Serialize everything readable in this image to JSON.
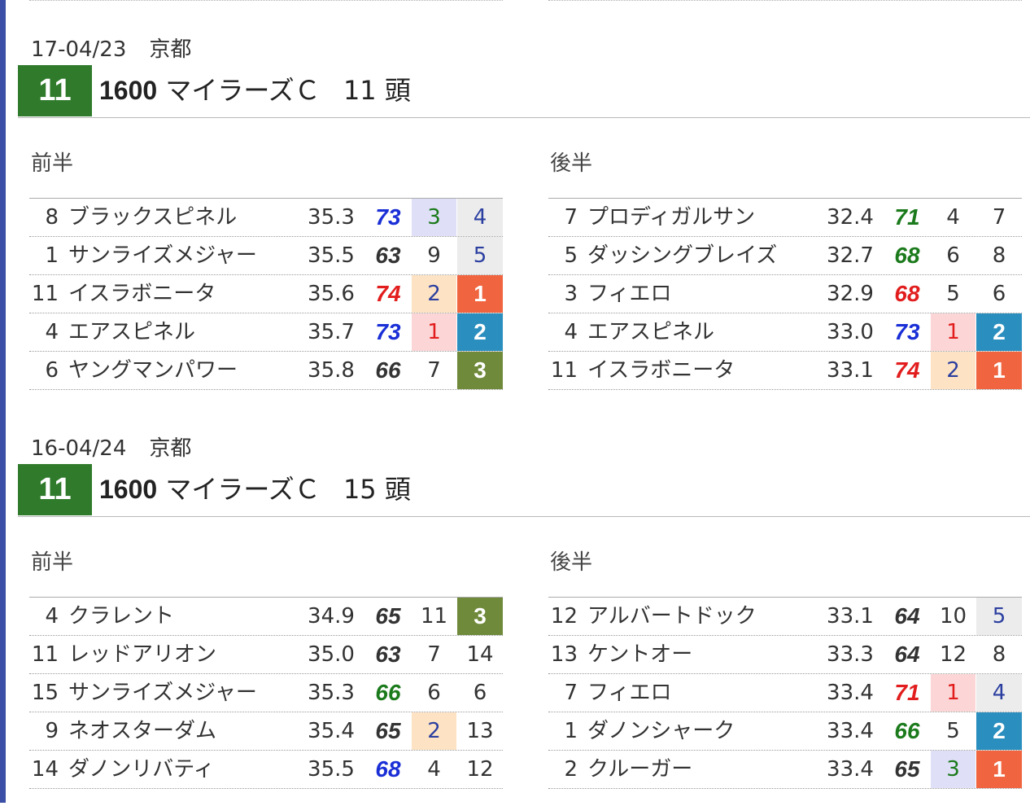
{
  "colors": {
    "race_number_bg": "#2f7a2b",
    "rank1": "#f06440",
    "rank2": "#2a8fbf",
    "rank3": "#6e8a3a",
    "index_blue": "#1a2fd6",
    "index_red": "#e21d1d",
    "index_green": "#1b7a1b",
    "index_black": "#333333",
    "pink_bg": "#fcd6d6",
    "peach_bg": "#fde3c3",
    "lavender_bg": "#dfdff7",
    "grey_bg": "#ececec"
  },
  "races": [
    {
      "date": "17-04/23",
      "venue": "京都",
      "race_number": "11",
      "distance": "1600",
      "name": "マイラーズＣ",
      "count": "11 頭",
      "first_half": {
        "label": "前半",
        "rows": [
          {
            "num": "8",
            "name": "ブラックスピネル",
            "time": "35.3",
            "index": "73",
            "index_color": "blue",
            "rank_a": "3",
            "rank_a_bg": "lavender",
            "rank_a_color": "#1b7a1b",
            "rank_b": "4",
            "rank_b_bg": "grey",
            "rank_b_color": "#2b3fa0"
          },
          {
            "num": "1",
            "name": "サンライズメジャー",
            "time": "35.5",
            "index": "63",
            "index_color": "black",
            "rank_a": "9",
            "rank_a_bg": "",
            "rank_a_color": "#333",
            "rank_b": "5",
            "rank_b_bg": "grey",
            "rank_b_color": "#2b3fa0"
          },
          {
            "num": "11",
            "name": "イスラボニータ",
            "time": "35.6",
            "index": "74",
            "index_color": "red",
            "rank_a": "2",
            "rank_a_bg": "peach",
            "rank_a_color": "#2b3fa0",
            "rank_b": "1",
            "rank_b_bg": "rank1",
            "rank_b_color": "#ffffff"
          },
          {
            "num": "4",
            "name": "エアスピネル",
            "time": "35.7",
            "index": "73",
            "index_color": "blue",
            "rank_a": "1",
            "rank_a_bg": "pink",
            "rank_a_color": "#e21d1d",
            "rank_b": "2",
            "rank_b_bg": "rank2",
            "rank_b_color": "#ffffff"
          },
          {
            "num": "6",
            "name": "ヤングマンパワー",
            "time": "35.8",
            "index": "66",
            "index_color": "black",
            "rank_a": "7",
            "rank_a_bg": "",
            "rank_a_color": "#333",
            "rank_b": "3",
            "rank_b_bg": "rank3",
            "rank_b_color": "#ffffff"
          }
        ]
      },
      "second_half": {
        "label": "後半",
        "rows": [
          {
            "num": "7",
            "name": "プロディガルサン",
            "time": "32.4",
            "index": "71",
            "index_color": "green",
            "rank_a": "4",
            "rank_a_bg": "",
            "rank_a_color": "#333",
            "rank_b": "7",
            "rank_b_bg": "",
            "rank_b_color": "#333"
          },
          {
            "num": "5",
            "name": "ダッシングブレイズ",
            "time": "32.7",
            "index": "68",
            "index_color": "green",
            "rank_a": "6",
            "rank_a_bg": "",
            "rank_a_color": "#333",
            "rank_b": "8",
            "rank_b_bg": "",
            "rank_b_color": "#333"
          },
          {
            "num": "3",
            "name": "フィエロ",
            "time": "32.9",
            "index": "68",
            "index_color": "red",
            "rank_a": "5",
            "rank_a_bg": "",
            "rank_a_color": "#333",
            "rank_b": "6",
            "rank_b_bg": "",
            "rank_b_color": "#333"
          },
          {
            "num": "4",
            "name": "エアスピネル",
            "time": "33.0",
            "index": "73",
            "index_color": "blue",
            "rank_a": "1",
            "rank_a_bg": "pink",
            "rank_a_color": "#e21d1d",
            "rank_b": "2",
            "rank_b_bg": "rank2",
            "rank_b_color": "#ffffff"
          },
          {
            "num": "11",
            "name": "イスラボニータ",
            "time": "33.1",
            "index": "74",
            "index_color": "red",
            "rank_a": "2",
            "rank_a_bg": "peach",
            "rank_a_color": "#2b3fa0",
            "rank_b": "1",
            "rank_b_bg": "rank1",
            "rank_b_color": "#ffffff"
          }
        ]
      }
    },
    {
      "date": "16-04/24",
      "venue": "京都",
      "race_number": "11",
      "distance": "1600",
      "name": "マイラーズＣ",
      "count": "15 頭",
      "first_half": {
        "label": "前半",
        "rows": [
          {
            "num": "4",
            "name": "クラレント",
            "time": "34.9",
            "index": "65",
            "index_color": "black",
            "rank_a": "11",
            "rank_a_bg": "",
            "rank_a_color": "#333",
            "rank_b": "3",
            "rank_b_bg": "rank3",
            "rank_b_color": "#ffffff"
          },
          {
            "num": "11",
            "name": "レッドアリオン",
            "time": "35.0",
            "index": "63",
            "index_color": "black",
            "rank_a": "7",
            "rank_a_bg": "",
            "rank_a_color": "#333",
            "rank_b": "14",
            "rank_b_bg": "",
            "rank_b_color": "#333"
          },
          {
            "num": "15",
            "name": "サンライズメジャー",
            "time": "35.3",
            "index": "66",
            "index_color": "green",
            "rank_a": "6",
            "rank_a_bg": "",
            "rank_a_color": "#333",
            "rank_b": "6",
            "rank_b_bg": "",
            "rank_b_color": "#333"
          },
          {
            "num": "9",
            "name": "ネオスターダム",
            "time": "35.4",
            "index": "65",
            "index_color": "black",
            "rank_a": "2",
            "rank_a_bg": "peach",
            "rank_a_color": "#2b3fa0",
            "rank_b": "13",
            "rank_b_bg": "",
            "rank_b_color": "#333"
          },
          {
            "num": "14",
            "name": "ダノンリバティ",
            "time": "35.5",
            "index": "68",
            "index_color": "blue",
            "rank_a": "4",
            "rank_a_bg": "",
            "rank_a_color": "#333",
            "rank_b": "12",
            "rank_b_bg": "",
            "rank_b_color": "#333"
          }
        ]
      },
      "second_half": {
        "label": "後半",
        "rows": [
          {
            "num": "12",
            "name": "アルバートドック",
            "time": "33.1",
            "index": "64",
            "index_color": "black",
            "rank_a": "10",
            "rank_a_bg": "",
            "rank_a_color": "#333",
            "rank_b": "5",
            "rank_b_bg": "grey",
            "rank_b_color": "#2b3fa0"
          },
          {
            "num": "13",
            "name": "ケントオー",
            "time": "33.3",
            "index": "64",
            "index_color": "black",
            "rank_a": "12",
            "rank_a_bg": "",
            "rank_a_color": "#333",
            "rank_b": "8",
            "rank_b_bg": "",
            "rank_b_color": "#333"
          },
          {
            "num": "7",
            "name": "フィエロ",
            "time": "33.4",
            "index": "71",
            "index_color": "red",
            "rank_a": "1",
            "rank_a_bg": "pink",
            "rank_a_color": "#e21d1d",
            "rank_b": "4",
            "rank_b_bg": "grey",
            "rank_b_color": "#2b3fa0"
          },
          {
            "num": "1",
            "name": "ダノンシャーク",
            "time": "33.4",
            "index": "66",
            "index_color": "green",
            "rank_a": "5",
            "rank_a_bg": "",
            "rank_a_color": "#333",
            "rank_b": "2",
            "rank_b_bg": "rank2",
            "rank_b_color": "#ffffff"
          },
          {
            "num": "2",
            "name": "クルーガー",
            "time": "33.4",
            "index": "65",
            "index_color": "black",
            "rank_a": "3",
            "rank_a_bg": "lavender",
            "rank_a_color": "#1b7a1b",
            "rank_b": "1",
            "rank_b_bg": "rank1",
            "rank_b_color": "#ffffff"
          }
        ]
      }
    }
  ]
}
